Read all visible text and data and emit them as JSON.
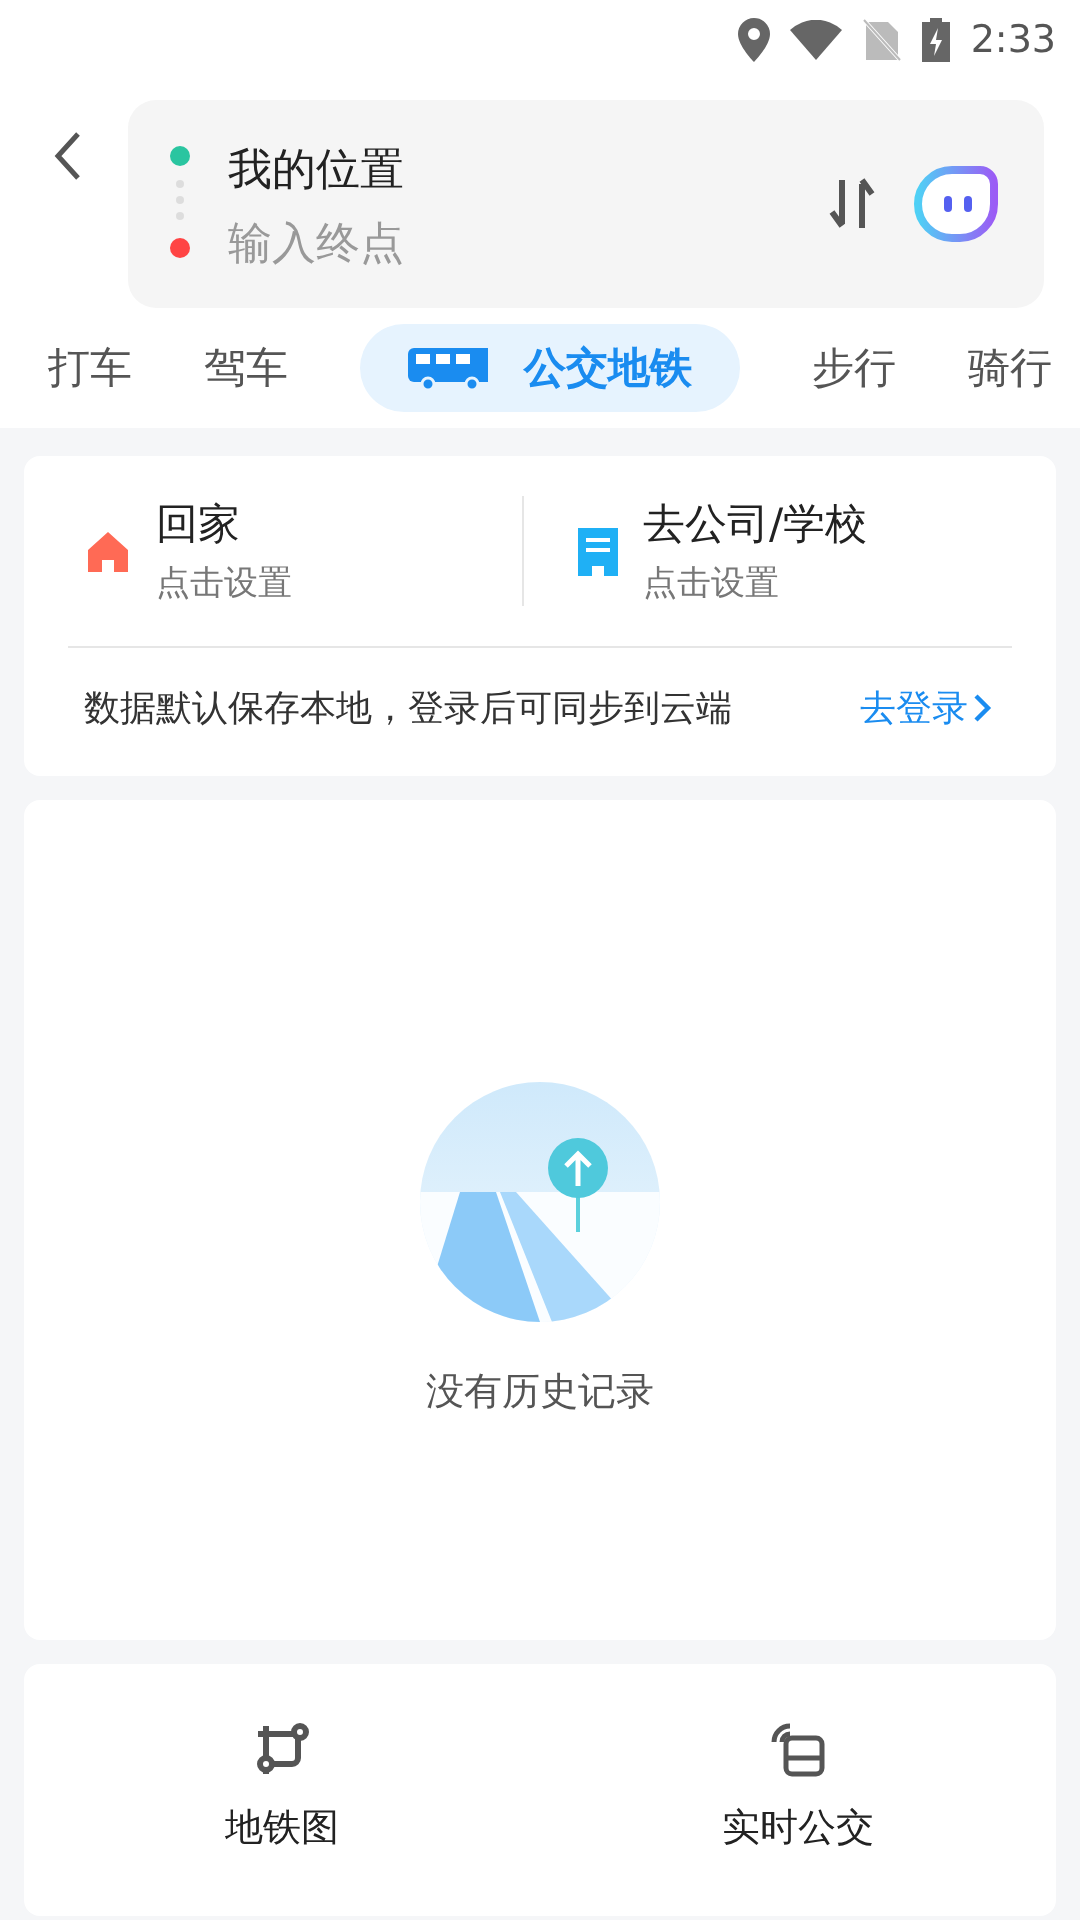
{
  "status_bar": {
    "time": "2:33"
  },
  "route": {
    "origin": "我的位置",
    "destination": {
      "placeholder": "输入终点"
    }
  },
  "modes": [
    {
      "label": "打车",
      "selected": false,
      "kind": "text"
    },
    {
      "label": "驾车",
      "selected": false,
      "kind": "text"
    },
    {
      "label": "公交地铁",
      "selected": true,
      "kind": "bus"
    },
    {
      "label": "步行",
      "selected": false,
      "kind": "text"
    },
    {
      "label": "骑行",
      "selected": false,
      "kind": "text"
    }
  ],
  "shortcuts": [
    {
      "kind": "home",
      "title": "回家",
      "subtitle": "点击设置"
    },
    {
      "kind": "work",
      "title": "去公司/学校",
      "subtitle": "点击设置"
    }
  ],
  "sync_notice": {
    "text": "数据默认保存本地，登录后可同步到云端",
    "link": "去登录"
  },
  "history": {
    "empty_text": "没有历史记录"
  },
  "tools": [
    {
      "kind": "subway",
      "label": "地铁图"
    },
    {
      "kind": "realtime",
      "label": "实时公交"
    }
  ]
}
